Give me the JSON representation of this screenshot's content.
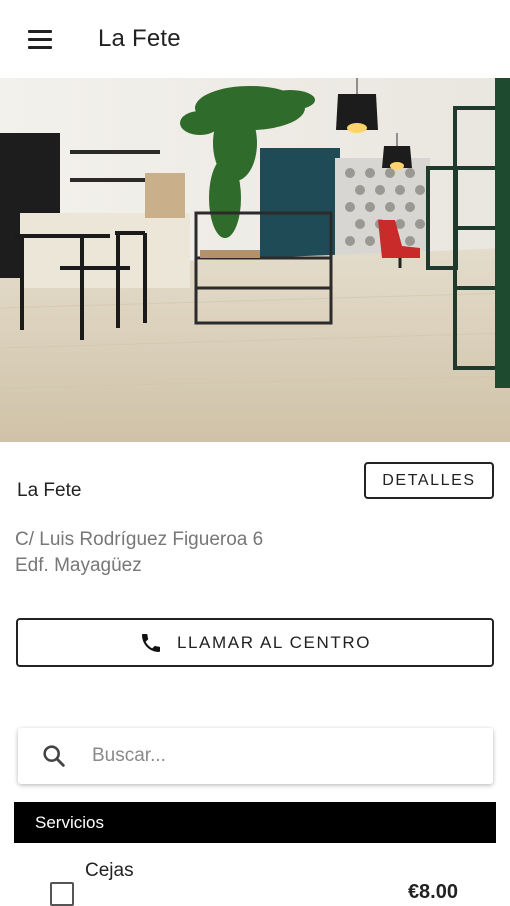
{
  "appbar": {
    "title": "La Fete",
    "menu_icon": "menu-icon"
  },
  "hero": {
    "image_desc": "salon-interior-photo"
  },
  "center": {
    "name": "La Fete",
    "details_label": "DETALLES",
    "address_line1": "C/ Luis Rodríguez Figueroa 6",
    "address_line2": "Edf. Mayagüez"
  },
  "call": {
    "label": "LLAMAR AL CENTRO",
    "icon": "phone-icon"
  },
  "search": {
    "placeholder": "Buscar...",
    "value": "",
    "icon": "search-icon"
  },
  "services": {
    "section_label": "Servicios",
    "items": [
      {
        "name": "Cejas",
        "price": "€8.00",
        "checked": false
      }
    ]
  }
}
